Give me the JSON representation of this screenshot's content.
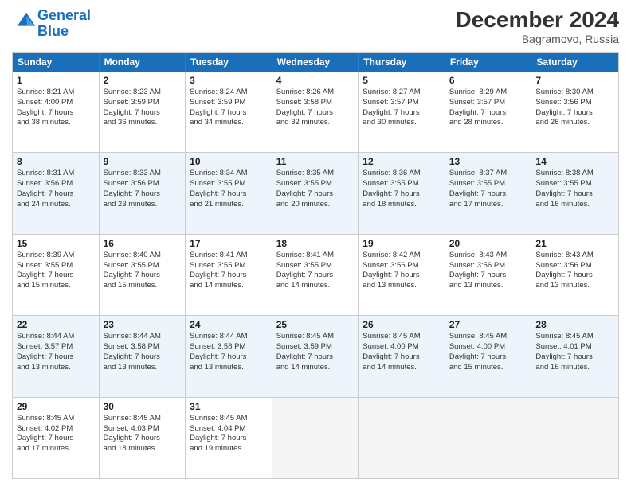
{
  "header": {
    "logo_line1": "General",
    "logo_line2": "Blue",
    "month_title": "December 2024",
    "location": "Bagramovo, Russia"
  },
  "days_of_week": [
    "Sunday",
    "Monday",
    "Tuesday",
    "Wednesday",
    "Thursday",
    "Friday",
    "Saturday"
  ],
  "rows": [
    [
      {
        "day": "1",
        "lines": [
          "Sunrise: 8:21 AM",
          "Sunset: 4:00 PM",
          "Daylight: 7 hours",
          "and 38 minutes."
        ]
      },
      {
        "day": "2",
        "lines": [
          "Sunrise: 8:23 AM",
          "Sunset: 3:59 PM",
          "Daylight: 7 hours",
          "and 36 minutes."
        ]
      },
      {
        "day": "3",
        "lines": [
          "Sunrise: 8:24 AM",
          "Sunset: 3:59 PM",
          "Daylight: 7 hours",
          "and 34 minutes."
        ]
      },
      {
        "day": "4",
        "lines": [
          "Sunrise: 8:26 AM",
          "Sunset: 3:58 PM",
          "Daylight: 7 hours",
          "and 32 minutes."
        ]
      },
      {
        "day": "5",
        "lines": [
          "Sunrise: 8:27 AM",
          "Sunset: 3:57 PM",
          "Daylight: 7 hours",
          "and 30 minutes."
        ]
      },
      {
        "day": "6",
        "lines": [
          "Sunrise: 8:29 AM",
          "Sunset: 3:57 PM",
          "Daylight: 7 hours",
          "and 28 minutes."
        ]
      },
      {
        "day": "7",
        "lines": [
          "Sunrise: 8:30 AM",
          "Sunset: 3:56 PM",
          "Daylight: 7 hours",
          "and 26 minutes."
        ]
      }
    ],
    [
      {
        "day": "8",
        "lines": [
          "Sunrise: 8:31 AM",
          "Sunset: 3:56 PM",
          "Daylight: 7 hours",
          "and 24 minutes."
        ]
      },
      {
        "day": "9",
        "lines": [
          "Sunrise: 8:33 AM",
          "Sunset: 3:56 PM",
          "Daylight: 7 hours",
          "and 23 minutes."
        ]
      },
      {
        "day": "10",
        "lines": [
          "Sunrise: 8:34 AM",
          "Sunset: 3:55 PM",
          "Daylight: 7 hours",
          "and 21 minutes."
        ]
      },
      {
        "day": "11",
        "lines": [
          "Sunrise: 8:35 AM",
          "Sunset: 3:55 PM",
          "Daylight: 7 hours",
          "and 20 minutes."
        ]
      },
      {
        "day": "12",
        "lines": [
          "Sunrise: 8:36 AM",
          "Sunset: 3:55 PM",
          "Daylight: 7 hours",
          "and 18 minutes."
        ]
      },
      {
        "day": "13",
        "lines": [
          "Sunrise: 8:37 AM",
          "Sunset: 3:55 PM",
          "Daylight: 7 hours",
          "and 17 minutes."
        ]
      },
      {
        "day": "14",
        "lines": [
          "Sunrise: 8:38 AM",
          "Sunset: 3:55 PM",
          "Daylight: 7 hours",
          "and 16 minutes."
        ]
      }
    ],
    [
      {
        "day": "15",
        "lines": [
          "Sunrise: 8:39 AM",
          "Sunset: 3:55 PM",
          "Daylight: 7 hours",
          "and 15 minutes."
        ]
      },
      {
        "day": "16",
        "lines": [
          "Sunrise: 8:40 AM",
          "Sunset: 3:55 PM",
          "Daylight: 7 hours",
          "and 15 minutes."
        ]
      },
      {
        "day": "17",
        "lines": [
          "Sunrise: 8:41 AM",
          "Sunset: 3:55 PM",
          "Daylight: 7 hours",
          "and 14 minutes."
        ]
      },
      {
        "day": "18",
        "lines": [
          "Sunrise: 8:41 AM",
          "Sunset: 3:55 PM",
          "Daylight: 7 hours",
          "and 14 minutes."
        ]
      },
      {
        "day": "19",
        "lines": [
          "Sunrise: 8:42 AM",
          "Sunset: 3:56 PM",
          "Daylight: 7 hours",
          "and 13 minutes."
        ]
      },
      {
        "day": "20",
        "lines": [
          "Sunrise: 8:43 AM",
          "Sunset: 3:56 PM",
          "Daylight: 7 hours",
          "and 13 minutes."
        ]
      },
      {
        "day": "21",
        "lines": [
          "Sunrise: 8:43 AM",
          "Sunset: 3:56 PM",
          "Daylight: 7 hours",
          "and 13 minutes."
        ]
      }
    ],
    [
      {
        "day": "22",
        "lines": [
          "Sunrise: 8:44 AM",
          "Sunset: 3:57 PM",
          "Daylight: 7 hours",
          "and 13 minutes."
        ]
      },
      {
        "day": "23",
        "lines": [
          "Sunrise: 8:44 AM",
          "Sunset: 3:58 PM",
          "Daylight: 7 hours",
          "and 13 minutes."
        ]
      },
      {
        "day": "24",
        "lines": [
          "Sunrise: 8:44 AM",
          "Sunset: 3:58 PM",
          "Daylight: 7 hours",
          "and 13 minutes."
        ]
      },
      {
        "day": "25",
        "lines": [
          "Sunrise: 8:45 AM",
          "Sunset: 3:59 PM",
          "Daylight: 7 hours",
          "and 14 minutes."
        ]
      },
      {
        "day": "26",
        "lines": [
          "Sunrise: 8:45 AM",
          "Sunset: 4:00 PM",
          "Daylight: 7 hours",
          "and 14 minutes."
        ]
      },
      {
        "day": "27",
        "lines": [
          "Sunrise: 8:45 AM",
          "Sunset: 4:00 PM",
          "Daylight: 7 hours",
          "and 15 minutes."
        ]
      },
      {
        "day": "28",
        "lines": [
          "Sunrise: 8:45 AM",
          "Sunset: 4:01 PM",
          "Daylight: 7 hours",
          "and 16 minutes."
        ]
      }
    ],
    [
      {
        "day": "29",
        "lines": [
          "Sunrise: 8:45 AM",
          "Sunset: 4:02 PM",
          "Daylight: 7 hours",
          "and 17 minutes."
        ]
      },
      {
        "day": "30",
        "lines": [
          "Sunrise: 8:45 AM",
          "Sunset: 4:03 PM",
          "Daylight: 7 hours",
          "and 18 minutes."
        ]
      },
      {
        "day": "31",
        "lines": [
          "Sunrise: 8:45 AM",
          "Sunset: 4:04 PM",
          "Daylight: 7 hours",
          "and 19 minutes."
        ]
      },
      {
        "day": "",
        "lines": []
      },
      {
        "day": "",
        "lines": []
      },
      {
        "day": "",
        "lines": []
      },
      {
        "day": "",
        "lines": []
      }
    ]
  ]
}
